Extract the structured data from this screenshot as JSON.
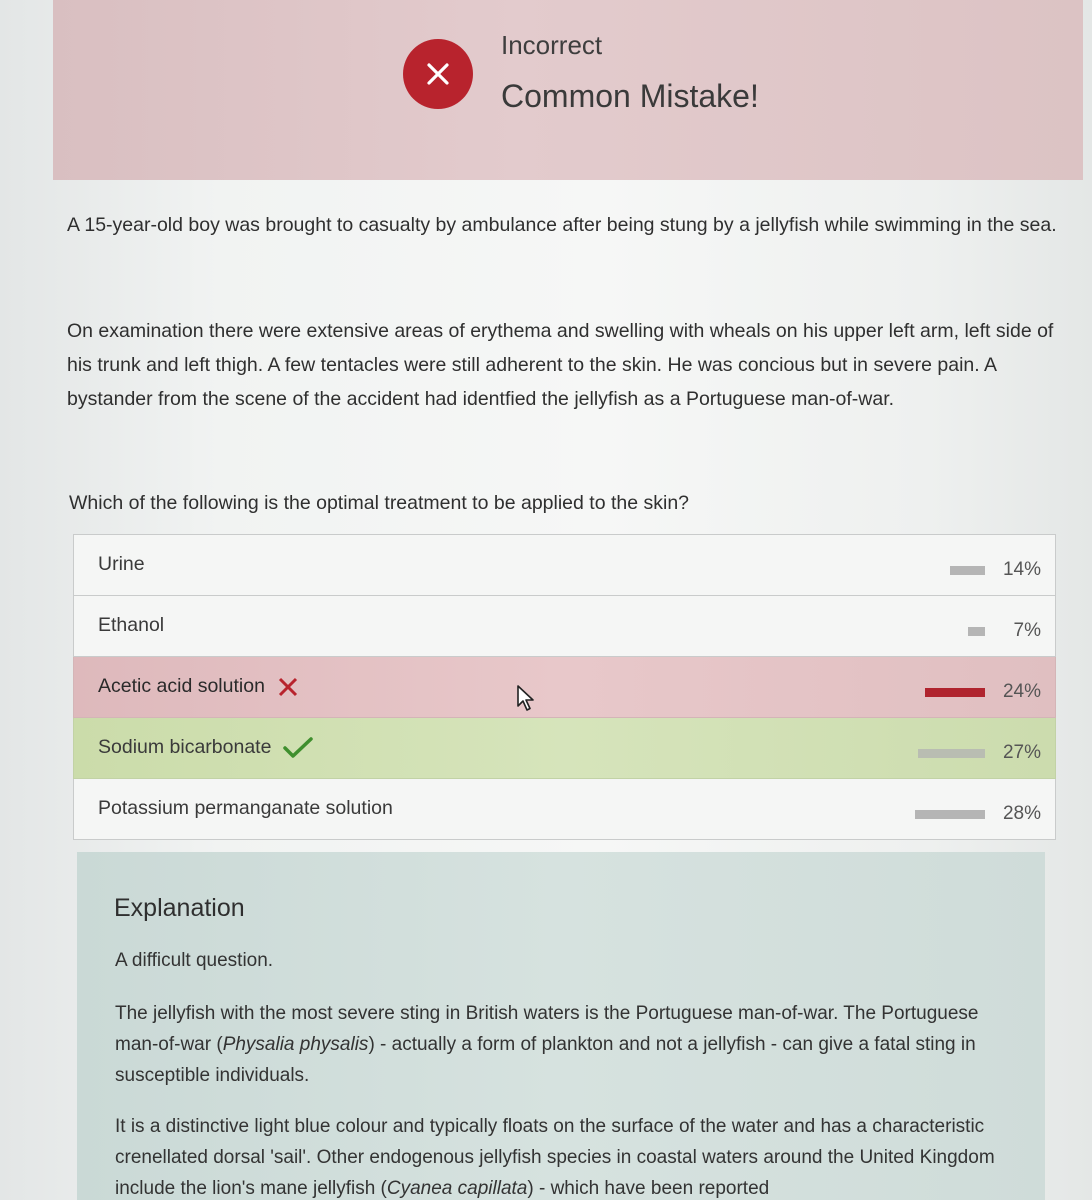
{
  "banner": {
    "status_title": "Incorrect",
    "status_subtitle": "Common Mistake!",
    "icon": "close-icon",
    "accent_color": "#b8232d"
  },
  "question": {
    "stem_paragraphs": [
      "A 15-year-old boy was brought to casualty by ambulance after being stung by a jellyfish while swimming in the sea.",
      "On examination there were extensive areas of erythema and swelling with wheals on his upper left arm, left side of his trunk and left thigh. A few tentacles were still adherent to the skin. He was concious but in severe pain. A bystander from the scene of the accident had identfied the jellyfish as a Portuguese man-of-war."
    ],
    "prompt": "Which of the following is the optimal treatment to be applied to the skin?"
  },
  "options": [
    {
      "label": "Urine",
      "percent_label": "14%",
      "percent": 14,
      "state": "none"
    },
    {
      "label": "Ethanol",
      "percent_label": "7%",
      "percent": 7,
      "state": "none"
    },
    {
      "label": "Acetic acid solution",
      "percent_label": "24%",
      "percent": 24,
      "state": "selected-incorrect",
      "mark_icon": "cross-icon"
    },
    {
      "label": "Sodium bicarbonate",
      "percent_label": "27%",
      "percent": 27,
      "state": "correct",
      "mark_icon": "checkmark-icon"
    },
    {
      "label": "Potassium permanganate solution",
      "percent_label": "28%",
      "percent": 28,
      "state": "none"
    }
  ],
  "explanation": {
    "title": "Explanation",
    "p1": "A difficult question.",
    "p2_before": "The jellyfish with the most severe sting in British waters is the Portuguese man-of-war. The Portuguese man-of-war (",
    "p2_italic": "Physalia physalis",
    "p2_after": ") - actually a form of plankton and not a jellyfish - can give a fatal sting in susceptible individuals.",
    "p3_before": "It is a distinctive light blue colour and typically floats on the surface of the water and has a characteristic crenellated dorsal 'sail'. Other endogenous jellyfish species in coastal waters around the United Kingdom include the lion's mane jellyfish (",
    "p3_italic": "Cyanea capillata",
    "p3_after": ") - which have been reported"
  }
}
